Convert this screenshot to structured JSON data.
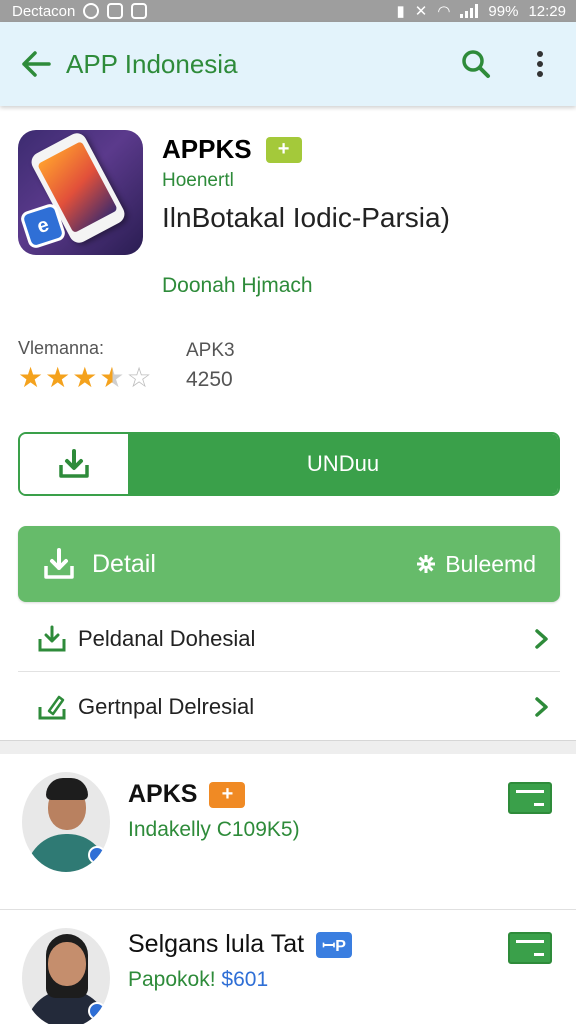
{
  "status_bar": {
    "carrier": "Dectacon",
    "battery": "99%",
    "time": "12:29"
  },
  "app_bar": {
    "title": "APP Indonesia"
  },
  "app": {
    "name": "APPKS",
    "tag": "+",
    "developer": "Hoenertl",
    "subtitle": "IlnBotakal Iodic-Parsia)",
    "offer": "Doonah Hjmach",
    "rating_label": "Vlemanna:",
    "rating_value": 3.5,
    "meta_label": "APK3",
    "meta_count": "4250"
  },
  "download_button": {
    "label": "UNDuu"
  },
  "detail_button": {
    "label": "Detail",
    "right_label": "Buleemd"
  },
  "links": [
    {
      "label": "Peldanal Dohesial"
    },
    {
      "label": "Gertnpal Delresial"
    }
  ],
  "list_items": [
    {
      "title": "APKS",
      "tag": "+",
      "subtitle": "Indakelly C109K5)"
    },
    {
      "title": "Selgans lula Tat",
      "tag": "ꟷP",
      "subtitle_text": "Papokok!",
      "subtitle_price": "$601"
    }
  ],
  "colors": {
    "accent": "#3aa04a",
    "app_bar_bg": "#e3f3fb",
    "link_green": "#2e8b3a",
    "star": "#f4a21d"
  },
  "icons": [
    "back-arrow-icon",
    "search-icon",
    "more-vert-icon",
    "download-icon",
    "gear-icon",
    "chevron-right-icon",
    "card-icon"
  ]
}
